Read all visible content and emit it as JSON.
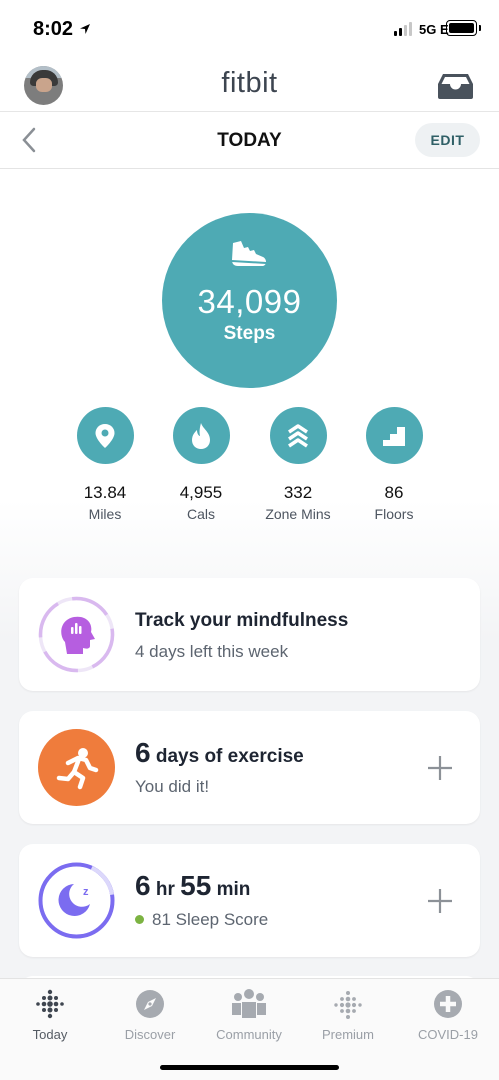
{
  "status_bar": {
    "time": "8:02",
    "network": "5G E"
  },
  "header": {
    "brand": "fitbit"
  },
  "nav": {
    "title": "TODAY",
    "edit_label": "EDIT"
  },
  "steps": {
    "value": "34,099",
    "label": "Steps"
  },
  "stats": [
    {
      "value": "13.84",
      "label": "Miles",
      "icon": "location-pin-icon"
    },
    {
      "value": "4,955",
      "label": "Cals",
      "icon": "flame-icon"
    },
    {
      "value": "332",
      "label": "Zone Mins",
      "icon": "chevrons-up-icon"
    },
    {
      "value": "86",
      "label": "Floors",
      "icon": "stairs-icon"
    }
  ],
  "cards": {
    "mindfulness": {
      "title": "Track your mindfulness",
      "subtitle": "4 days left this week",
      "icon": "mindful-head-icon"
    },
    "exercise": {
      "count": "6",
      "title": "days of exercise",
      "subtitle": "You did it!",
      "icon": "running-icon"
    },
    "sleep": {
      "hours": "6",
      "hours_unit": "hr",
      "minutes": "55",
      "minutes_unit": "min",
      "score": "81 Sleep Score",
      "icon": "moon-icon"
    }
  },
  "tabs": [
    {
      "label": "Today",
      "icon": "dots-grid-icon",
      "active": true
    },
    {
      "label": "Discover",
      "icon": "compass-icon",
      "active": false
    },
    {
      "label": "Community",
      "icon": "people-icon",
      "active": false
    },
    {
      "label": "Premium",
      "icon": "dots-grid-icon",
      "active": false
    },
    {
      "label": "COVID-19",
      "icon": "plus-circle-icon",
      "active": false
    }
  ],
  "colors": {
    "teal": "#4eaab4",
    "exercise_orange": "#ef7c3c",
    "sleep_purple": "#7b6cf0",
    "mindful_purple": "#b65ee0",
    "sleep_dot_green": "#7cb342"
  }
}
